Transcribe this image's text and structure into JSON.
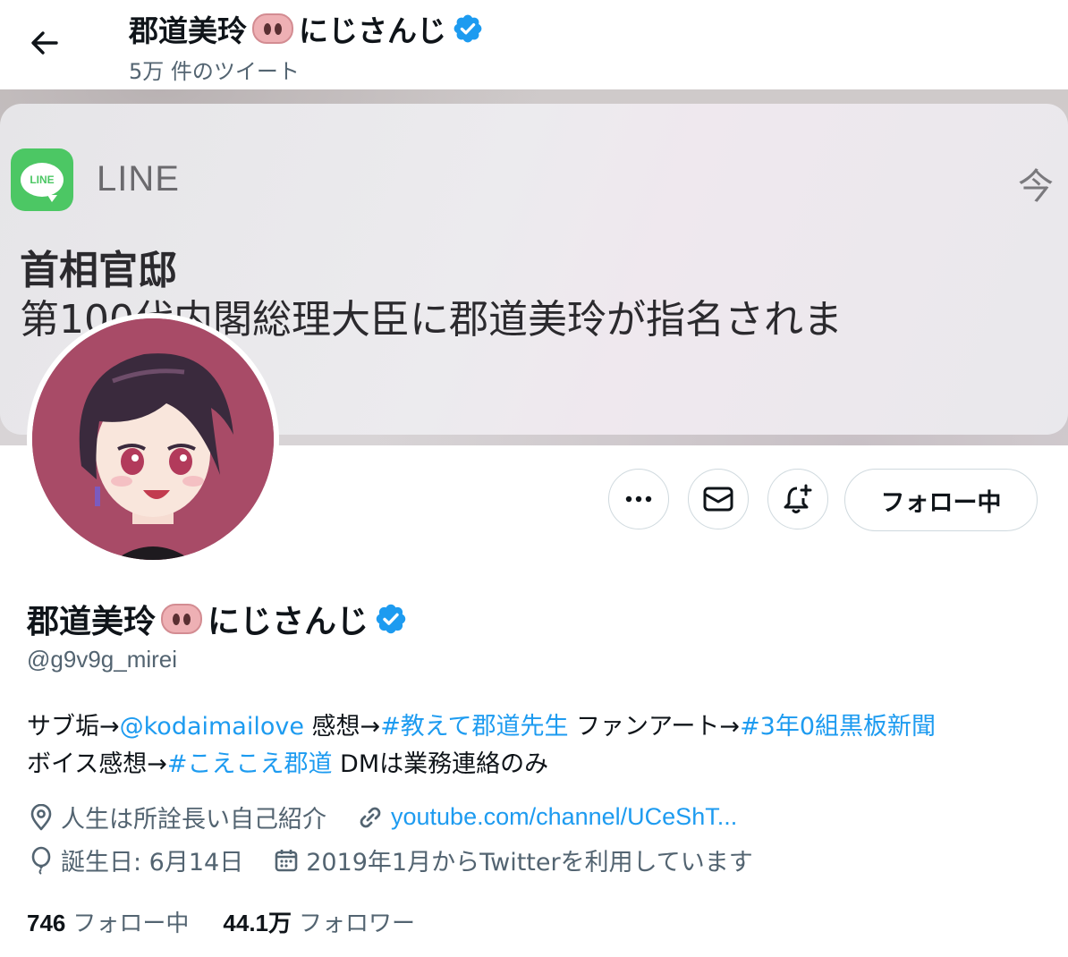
{
  "header": {
    "title": "郡道美玲",
    "title_suffix": "にじさんじ",
    "tweet_count": "5万 件のツイート"
  },
  "banner": {
    "app_name": "LINE",
    "app_icon_label": "LINE",
    "time": "今",
    "sender": "首相官邸",
    "body": "第100代内閣総理大臣に郡道美玲が指名されま"
  },
  "actions": {
    "follow_label": "フォロー中"
  },
  "profile": {
    "name": "郡道美玲",
    "name_suffix": "にじさんじ",
    "handle": "@g9v9g_mirei",
    "bio": {
      "t1": "サブ垢→",
      "link1": "@kodaimailove",
      "t2": " 感想→",
      "link2": "#教えて郡道先生",
      "t3": " ファンアート→",
      "link3": "#3年0組黒板新聞",
      "t4": "ボイス感想→",
      "link4": "#こえこえ郡道",
      "t5": " DMは業務連絡のみ"
    },
    "location": "人生は所詮長い自己紹介",
    "website": "youtube.com/channel/UCeShT...",
    "birthday": "誕生日: 6月14日",
    "joined": "2019年1月からTwitterを利用しています"
  },
  "stats": {
    "following_count": "746",
    "following_label": "フォロー中",
    "followers_count": "44.1万",
    "followers_label": "フォロワー"
  },
  "colors": {
    "accent": "#1d9bf0",
    "secondary_text": "#536471",
    "line_green": "#4cc764",
    "avatar_bg": "#a84b67"
  }
}
